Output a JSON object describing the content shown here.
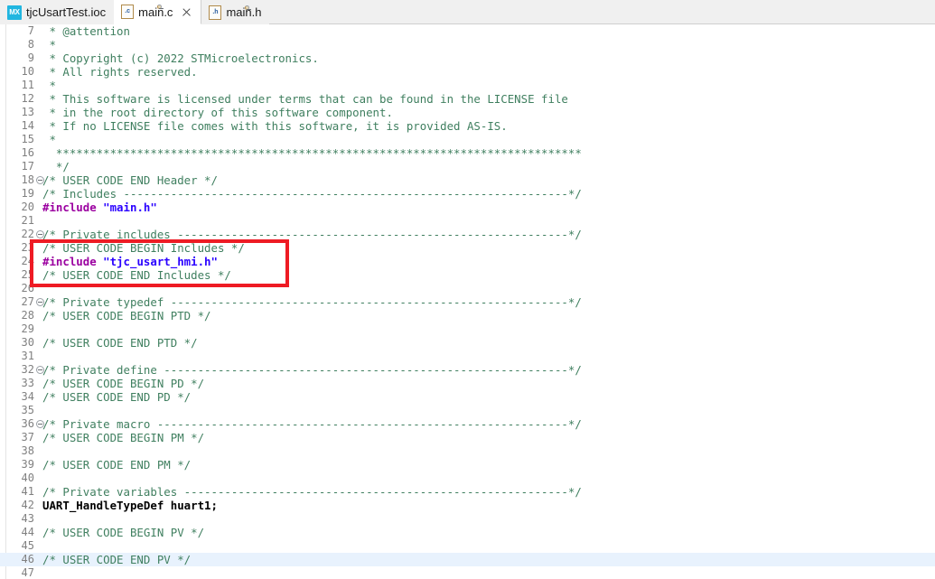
{
  "window": {
    "title": "main.c"
  },
  "tab_bar": {
    "tabs": [
      {
        "label": "tjcUsartTest.ioc",
        "icon": "mx-icon",
        "icon_text": "MX",
        "active": false,
        "closable": false
      },
      {
        "label": "main.c",
        "icon": "c-file-icon",
        "icon_text": ".c",
        "active": true,
        "closable": true
      },
      {
        "label": "main.h",
        "icon": "h-file-icon",
        "icon_text": ".h",
        "active": false,
        "closable": false
      }
    ]
  },
  "editor": {
    "first_line_number": 7,
    "current_line_number": 46,
    "lines": [
      {
        "n": 7,
        "fold": false,
        "tokens": [
          {
            "t": "cmt",
            "v": " * @attention"
          }
        ]
      },
      {
        "n": 8,
        "fold": false,
        "tokens": [
          {
            "t": "cmt",
            "v": " *"
          }
        ]
      },
      {
        "n": 9,
        "fold": false,
        "tokens": [
          {
            "t": "cmt",
            "v": " * Copyright (c) 2022 STMicroelectronics."
          }
        ]
      },
      {
        "n": 10,
        "fold": false,
        "tokens": [
          {
            "t": "cmt",
            "v": " * All rights reserved."
          }
        ]
      },
      {
        "n": 11,
        "fold": false,
        "tokens": [
          {
            "t": "cmt",
            "v": " *"
          }
        ]
      },
      {
        "n": 12,
        "fold": false,
        "tokens": [
          {
            "t": "cmt",
            "v": " * This software is licensed under terms that can be found in the LICENSE file"
          }
        ]
      },
      {
        "n": 13,
        "fold": false,
        "tokens": [
          {
            "t": "cmt",
            "v": " * in the root directory of this software component."
          }
        ]
      },
      {
        "n": 14,
        "fold": false,
        "tokens": [
          {
            "t": "cmt",
            "v": " * If no LICENSE file comes with this software, it is provided AS-IS."
          }
        ]
      },
      {
        "n": 15,
        "fold": false,
        "tokens": [
          {
            "t": "cmt",
            "v": " *"
          }
        ]
      },
      {
        "n": 16,
        "fold": false,
        "tokens": [
          {
            "t": "cmt",
            "v": "  ******************************************************************************"
          }
        ]
      },
      {
        "n": 17,
        "fold": false,
        "tokens": [
          {
            "t": "cmt",
            "v": "  */"
          }
        ]
      },
      {
        "n": 18,
        "fold": true,
        "tokens": [
          {
            "t": "cmt",
            "v": "/* USER CODE END Header */"
          }
        ]
      },
      {
        "n": 19,
        "fold": false,
        "tokens": [
          {
            "t": "cmt",
            "v": "/* Includes ------------------------------------------------------------------*/"
          }
        ]
      },
      {
        "n": 20,
        "fold": false,
        "tokens": [
          {
            "t": "prep",
            "v": "#include "
          },
          {
            "t": "str",
            "v": "\"main.h\""
          }
        ]
      },
      {
        "n": 21,
        "fold": false,
        "tokens": []
      },
      {
        "n": 22,
        "fold": true,
        "tokens": [
          {
            "t": "cmt",
            "v": "/* Private includes ----------------------------------------------------------*/"
          }
        ]
      },
      {
        "n": 23,
        "fold": false,
        "tokens": [
          {
            "t": "cmt",
            "v": "/* USER CODE BEGIN Includes */"
          }
        ]
      },
      {
        "n": 24,
        "fold": false,
        "tokens": [
          {
            "t": "prep",
            "v": "#include "
          },
          {
            "t": "str",
            "v": "\"tjc_usart_hmi.h\""
          }
        ]
      },
      {
        "n": 25,
        "fold": false,
        "tokens": [
          {
            "t": "cmt",
            "v": "/* USER CODE END Includes */"
          }
        ]
      },
      {
        "n": 26,
        "fold": false,
        "tokens": []
      },
      {
        "n": 27,
        "fold": true,
        "tokens": [
          {
            "t": "cmt",
            "v": "/* Private typedef -----------------------------------------------------------*/"
          }
        ]
      },
      {
        "n": 28,
        "fold": false,
        "tokens": [
          {
            "t": "cmt",
            "v": "/* USER CODE BEGIN PTD */"
          }
        ]
      },
      {
        "n": 29,
        "fold": false,
        "tokens": []
      },
      {
        "n": 30,
        "fold": false,
        "tokens": [
          {
            "t": "cmt",
            "v": "/* USER CODE END PTD */"
          }
        ]
      },
      {
        "n": 31,
        "fold": false,
        "tokens": []
      },
      {
        "n": 32,
        "fold": true,
        "tokens": [
          {
            "t": "cmt",
            "v": "/* Private define ------------------------------------------------------------*/"
          }
        ]
      },
      {
        "n": 33,
        "fold": false,
        "tokens": [
          {
            "t": "cmt",
            "v": "/* USER CODE BEGIN PD */"
          }
        ]
      },
      {
        "n": 34,
        "fold": false,
        "tokens": [
          {
            "t": "cmt",
            "v": "/* USER CODE END PD */"
          }
        ]
      },
      {
        "n": 35,
        "fold": false,
        "tokens": []
      },
      {
        "n": 36,
        "fold": true,
        "tokens": [
          {
            "t": "cmt",
            "v": "/* Private macro -------------------------------------------------------------*/"
          }
        ]
      },
      {
        "n": 37,
        "fold": false,
        "tokens": [
          {
            "t": "cmt",
            "v": "/* USER CODE BEGIN PM */"
          }
        ]
      },
      {
        "n": 38,
        "fold": false,
        "tokens": []
      },
      {
        "n": 39,
        "fold": false,
        "tokens": [
          {
            "t": "cmt",
            "v": "/* USER CODE END PM */"
          }
        ]
      },
      {
        "n": 40,
        "fold": false,
        "tokens": []
      },
      {
        "n": 41,
        "fold": false,
        "tokens": [
          {
            "t": "cmt",
            "v": "/* Private variables ---------------------------------------------------------*/"
          }
        ]
      },
      {
        "n": 42,
        "fold": false,
        "tokens": [
          {
            "t": "plain",
            "v": "UART_HandleTypeDef huart1;"
          }
        ]
      },
      {
        "n": 43,
        "fold": false,
        "tokens": []
      },
      {
        "n": 44,
        "fold": false,
        "tokens": [
          {
            "t": "cmt",
            "v": "/* USER CODE BEGIN PV */"
          }
        ]
      },
      {
        "n": 45,
        "fold": false,
        "tokens": []
      },
      {
        "n": 46,
        "fold": false,
        "tokens": [
          {
            "t": "cmt",
            "v": "/* USER CODE END PV */"
          }
        ]
      },
      {
        "n": 47,
        "fold": false,
        "tokens": []
      }
    ]
  },
  "annotation": {
    "color": "#ee1b24",
    "highlights_lines": [
      23,
      24,
      25
    ],
    "label": "user-include-highlight"
  },
  "colors": {
    "comment": "#3f7f5f",
    "preprocessor": "#9b00a0",
    "string": "#2a00ff",
    "plain_code": "#000000",
    "line_number": "#808080",
    "current_line_bg": "#e8f2fd",
    "tab_bar_bg": "#f0f0f0",
    "editor_bg": "#ffffff",
    "mx_badge": "#21b6e0"
  }
}
